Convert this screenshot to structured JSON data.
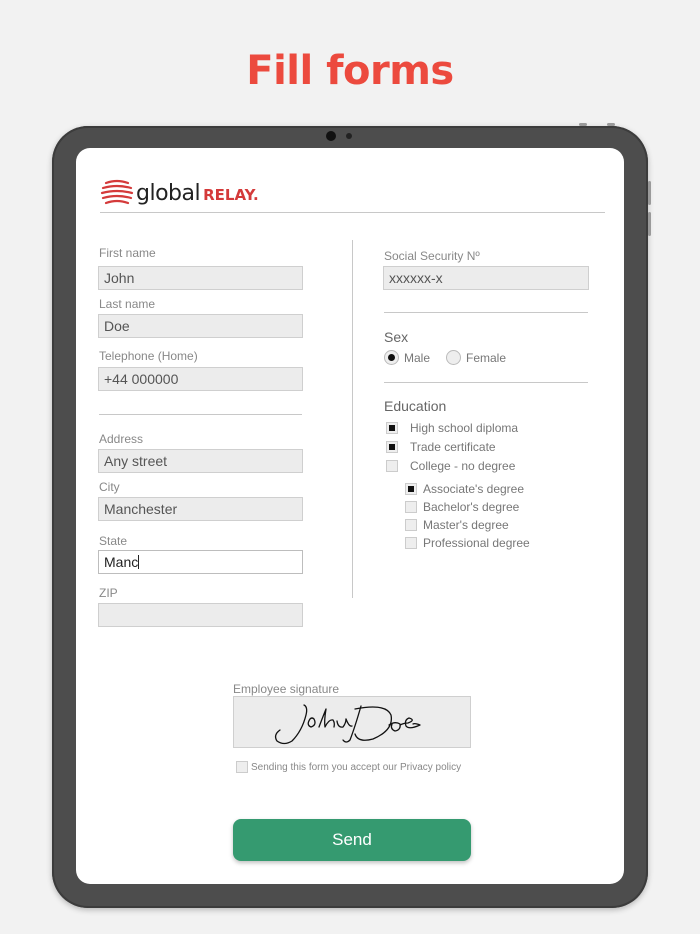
{
  "headline": "Fill forms",
  "logo": {
    "word1": "global",
    "word2": "RELAY."
  },
  "form": {
    "first_name": {
      "label": "First name",
      "value": "John"
    },
    "last_name": {
      "label": "Last name",
      "value": "Doe"
    },
    "telephone": {
      "label": "Telephone (Home)",
      "value": "+44 000000"
    },
    "address": {
      "label": "Address",
      "value": "Any street"
    },
    "city": {
      "label": "City",
      "value": "Manchester"
    },
    "state": {
      "label": "State",
      "value": "Manc"
    },
    "zip": {
      "label": "ZIP",
      "value": ""
    },
    "ssn": {
      "label": "Social Security Nº",
      "value": "xxxxxx-x"
    },
    "sex": {
      "label": "Sex",
      "options": [
        {
          "label": "Male",
          "selected": true
        },
        {
          "label": "Female",
          "selected": false
        }
      ]
    },
    "education": {
      "label": "Education",
      "options": [
        {
          "label": "High school diploma",
          "checked": true
        },
        {
          "label": "Trade certificate",
          "checked": true
        },
        {
          "label": "College - no degree",
          "checked": false
        }
      ],
      "sub_options": [
        {
          "label": "Associate's degree",
          "checked": true
        },
        {
          "label": "Bachelor's degree",
          "checked": false
        },
        {
          "label": "Master's degree",
          "checked": false
        },
        {
          "label": "Professional degree",
          "checked": false
        }
      ]
    },
    "signature": {
      "label": "Employee signature"
    },
    "privacy": {
      "label": "Sending this form you accept our Privacy policy",
      "checked": false
    },
    "send_label": "Send"
  },
  "colors": {
    "headline": "#ec4a3e",
    "send_button": "#359a70",
    "brand_red": "#d43a3a"
  }
}
